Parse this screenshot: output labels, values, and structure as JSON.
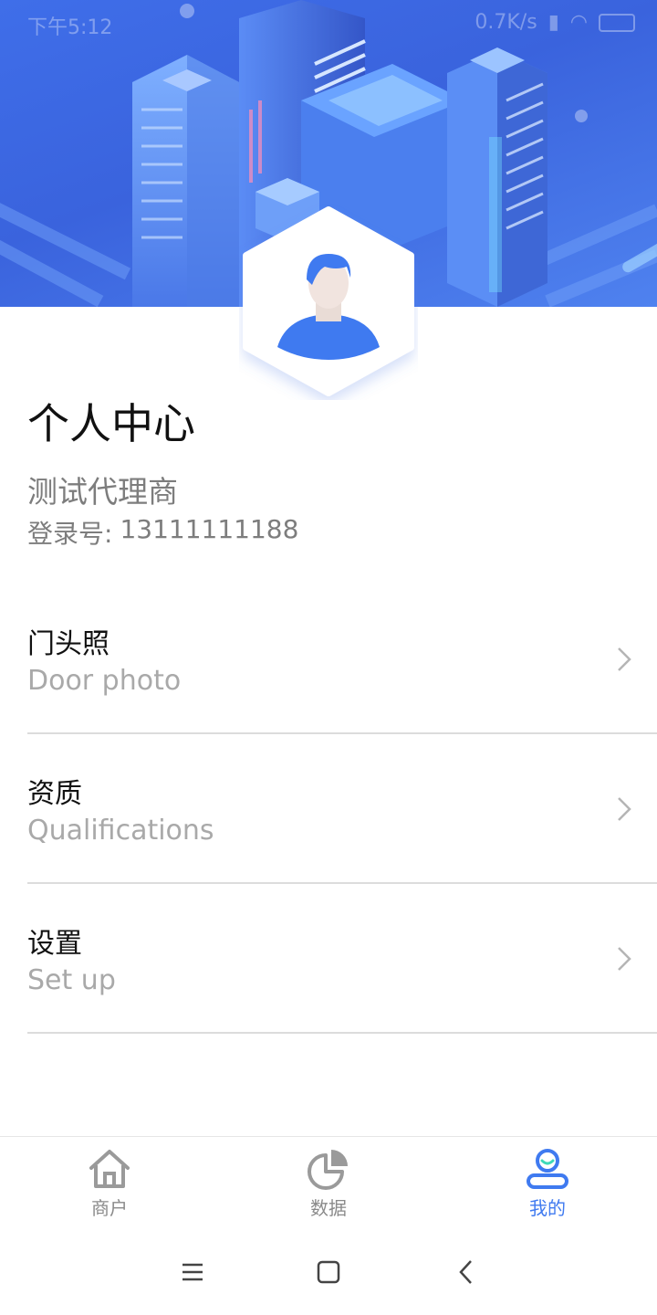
{
  "status_bar": {
    "time": "下午5:12",
    "speed": "0.7K/s"
  },
  "profile": {
    "title": "个人中心",
    "agent_name": "测试代理商",
    "login_label": "登录号:",
    "login_number": "13111111188"
  },
  "menu": [
    {
      "cn": "门头照",
      "en": "Door photo"
    },
    {
      "cn": "资质",
      "en": "Qualifications"
    },
    {
      "cn": "设置",
      "en": "Set up"
    }
  ],
  "tabbar": {
    "items": [
      {
        "label": "商户",
        "icon": "home-icon"
      },
      {
        "label": "数据",
        "icon": "pie-chart-icon"
      },
      {
        "label": "我的",
        "icon": "user-icon",
        "active": true
      }
    ]
  },
  "colors": {
    "accent": "#3f7af0",
    "banner": "#3f6ee9",
    "muted_text": "#7d7d7d",
    "hint_text": "#a9a9a9"
  }
}
